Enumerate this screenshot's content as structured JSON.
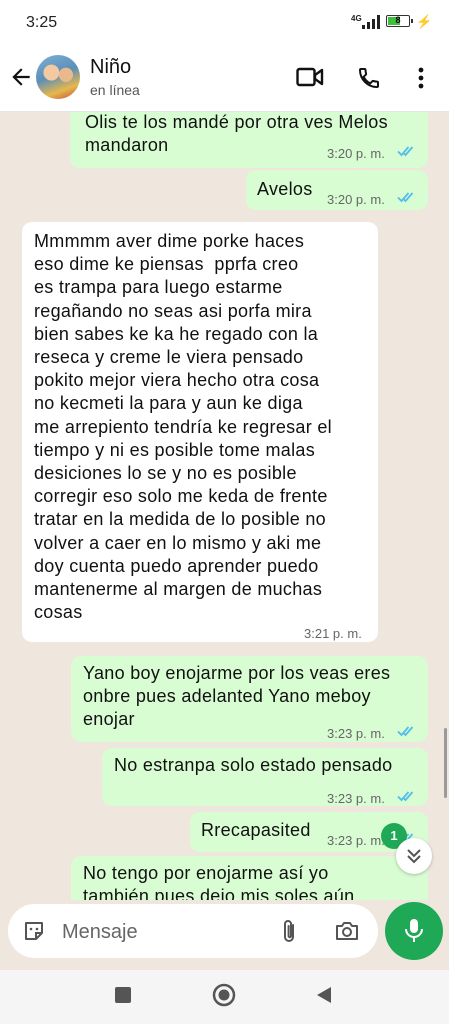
{
  "status_bar": {
    "time": "3:25",
    "network": "4G",
    "battery_level": "8"
  },
  "header": {
    "name": "Niño",
    "status": "en línea"
  },
  "messages": [
    {
      "dir": "out",
      "text": "Olis te los mandé por otra ves Melos\nmandaron",
      "time": "3:20 p. m."
    },
    {
      "dir": "out",
      "text": "Avelos",
      "time": "3:20 p. m."
    },
    {
      "dir": "in",
      "text": "Mmmmm aver dime porke haces\neso dime ke piensas  pprfa creo\nes trampa para luego estarme\nregañando no seas asi porfa mira\nbien sabes ke ka he regado con la\nreseca y creme le viera pensado\npokito mejor viera hecho otra cosa\nno kecmeti la para y aun ke diga\nme arrepiento tendría ke regresar el\ntiempo y ni es posible tome malas\ndesiciones lo se y no es posible\ncorregir eso solo me keda de frente\ntratar en la medida de lo posible no\nvolver a caer en lo mismo y aki me\ndoy cuenta puedo aprender puedo\nmantenerme al margen de muchas\ncosas",
      "time": "3:21 p. m."
    },
    {
      "dir": "out",
      "text": "Yano boy enojarme por los veas eres\nonbre pues adelanted Yano meboy\nenojar",
      "time": "3:23 p. m."
    },
    {
      "dir": "out",
      "text": "No estranpa solo estado pensado",
      "time": "3:23 p. m."
    },
    {
      "dir": "out",
      "text": "Rrecapasited",
      "time": "3:23 p. m."
    },
    {
      "dir": "out",
      "text": "No tengo por enojarme así yo\ntambién pues dejo mis soles aún",
      "time": ""
    }
  ],
  "unread_count": "1",
  "composer": {
    "placeholder": "Mensaje"
  },
  "colors": {
    "outgoing_bubble": "#d9fdd3",
    "incoming_bubble": "#ffffff",
    "accent": "#1fa855",
    "read_ticks": "#53bdeb",
    "wallpaper": "#efe7dd"
  },
  "icons": [
    "back-arrow-icon",
    "video-call-icon",
    "phone-icon",
    "more-options-icon",
    "read-ticks-icon",
    "sticker-icon",
    "attach-icon",
    "camera-icon",
    "mic-icon",
    "chevron-double-down-icon",
    "nav-recents-icon",
    "nav-home-icon",
    "nav-back-icon"
  ]
}
